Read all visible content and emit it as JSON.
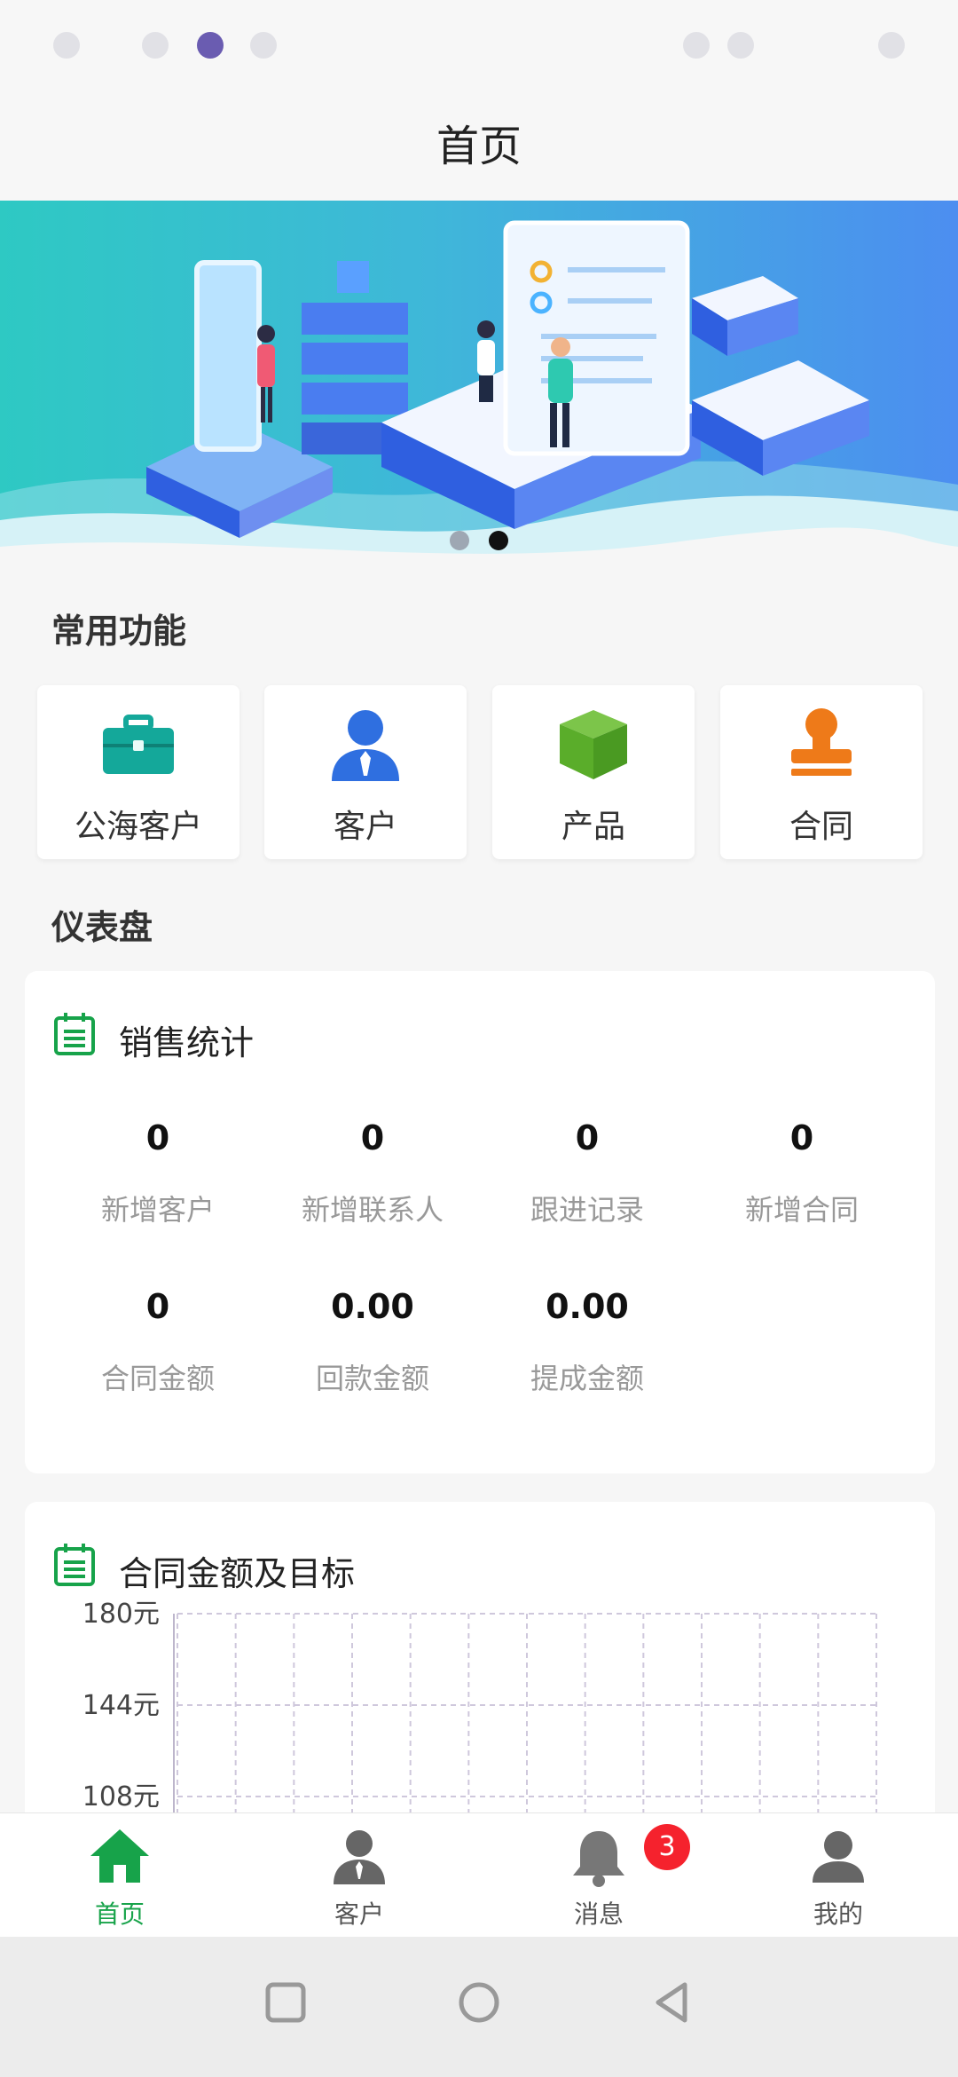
{
  "nav": {
    "title": "首页"
  },
  "banner": {
    "slides": 2,
    "active_index": 1
  },
  "quick": {
    "title": "常用功能",
    "items": [
      {
        "label": "公海客户",
        "icon": "briefcase-icon",
        "color": "#14a89a"
      },
      {
        "label": "客户",
        "icon": "user-icon",
        "color": "#2f6fe0"
      },
      {
        "label": "产品",
        "icon": "box-icon",
        "color": "#5aad2a"
      },
      {
        "label": "合同",
        "icon": "stamp-icon",
        "color": "#ee7a19"
      }
    ]
  },
  "dashboard": {
    "title": "仪表盘"
  },
  "sales": {
    "title": "销售统计",
    "stats": [
      {
        "value": "0",
        "label": "新增客户"
      },
      {
        "value": "0",
        "label": "新增联系人"
      },
      {
        "value": "0",
        "label": "跟进记录"
      },
      {
        "value": "0",
        "label": "新增合同"
      },
      {
        "value": "0",
        "label": "合同金额"
      },
      {
        "value": "0.00",
        "label": "回款金额"
      },
      {
        "value": "0.00",
        "label": "提成金额"
      }
    ]
  },
  "contract_chart": {
    "title": "合同金额及目标"
  },
  "chart_data": {
    "type": "bar",
    "title": "合同金额及目标",
    "categories": [
      "",
      "",
      "",
      "",
      "",
      "",
      "",
      "",
      "",
      "",
      "",
      ""
    ],
    "series": [],
    "ytick_labels": [
      "180元",
      "144元",
      "108元"
    ],
    "ylim": [
      108,
      180
    ],
    "grid": true
  },
  "tabbar": {
    "items": [
      {
        "label": "首页",
        "icon": "home-icon",
        "active": true
      },
      {
        "label": "客户",
        "icon": "agent-icon",
        "active": false
      },
      {
        "label": "消息",
        "icon": "bell-icon",
        "active": false,
        "badge": "3"
      },
      {
        "label": "我的",
        "icon": "profile-icon",
        "active": false
      }
    ]
  },
  "colors": {
    "accent": "#17a34a",
    "badge": "#f5222d",
    "label_gray": "#999999"
  }
}
